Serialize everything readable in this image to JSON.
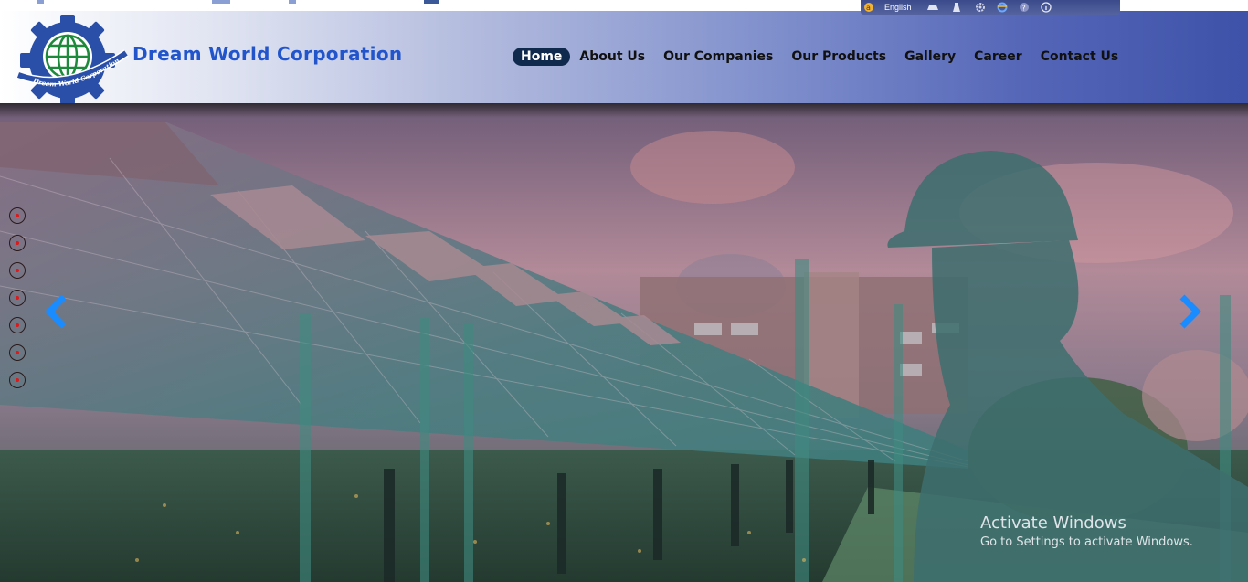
{
  "language_bar": {
    "language": "English"
  },
  "header": {
    "logo_text": "Dream World Corporation",
    "brand_name": "Dream World Corporation"
  },
  "nav": {
    "items": [
      {
        "label": "Home",
        "active": true
      },
      {
        "label": "About Us",
        "active": false
      },
      {
        "label": "Our Companies",
        "active": false
      },
      {
        "label": "Our Products",
        "active": false
      },
      {
        "label": "Gallery",
        "active": false
      },
      {
        "label": "Career",
        "active": false
      },
      {
        "label": "Contact Us",
        "active": false
      }
    ]
  },
  "slider": {
    "slide_count": 7,
    "current_slide": 1,
    "prev_icon": "chevron-left-icon",
    "next_icon": "chevron-right-icon"
  },
  "os_watermark": {
    "title": "Activate Windows",
    "subtitle": "Go to Settings to activate Windows."
  },
  "colors": {
    "brand_blue": "#2255cc",
    "nav_active_bg": "#0f2a4d",
    "arrow_blue": "#1a8cff",
    "dot_red": "#e01818"
  }
}
